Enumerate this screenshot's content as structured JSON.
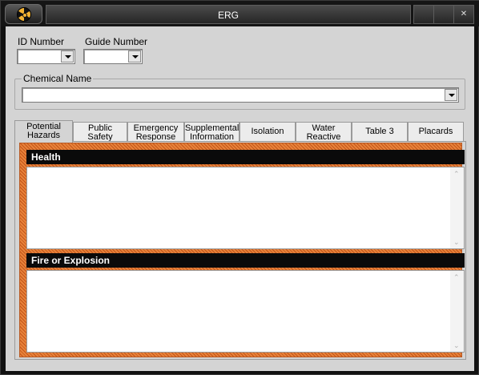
{
  "window": {
    "title": "ERG",
    "icon": "radiation-icon",
    "controls": {
      "minimize": "",
      "maximize": "",
      "close": "✕"
    }
  },
  "form": {
    "id_number_label": "ID Number",
    "id_number_value": "",
    "guide_number_label": "Guide Number",
    "guide_number_value": "",
    "chemical_name_label": "Chemical Name",
    "chemical_name_value": ""
  },
  "tabs": [
    {
      "label": "Potential\nHazards",
      "active": true
    },
    {
      "label": "Public\nSafety",
      "active": false
    },
    {
      "label": "Emergency\nResponse",
      "active": false
    },
    {
      "label": "Supplemental\nInformation",
      "active": false
    },
    {
      "label": "Isolation",
      "active": false
    },
    {
      "label": "Water\nReactive",
      "active": false
    },
    {
      "label": "Table 3",
      "active": false
    },
    {
      "label": "Placards",
      "active": false
    }
  ],
  "panel": {
    "health_header": "Health",
    "health_text": "",
    "fire_header": "Fire or Explosion",
    "fire_text": "",
    "accent_color": "#e8833a"
  }
}
